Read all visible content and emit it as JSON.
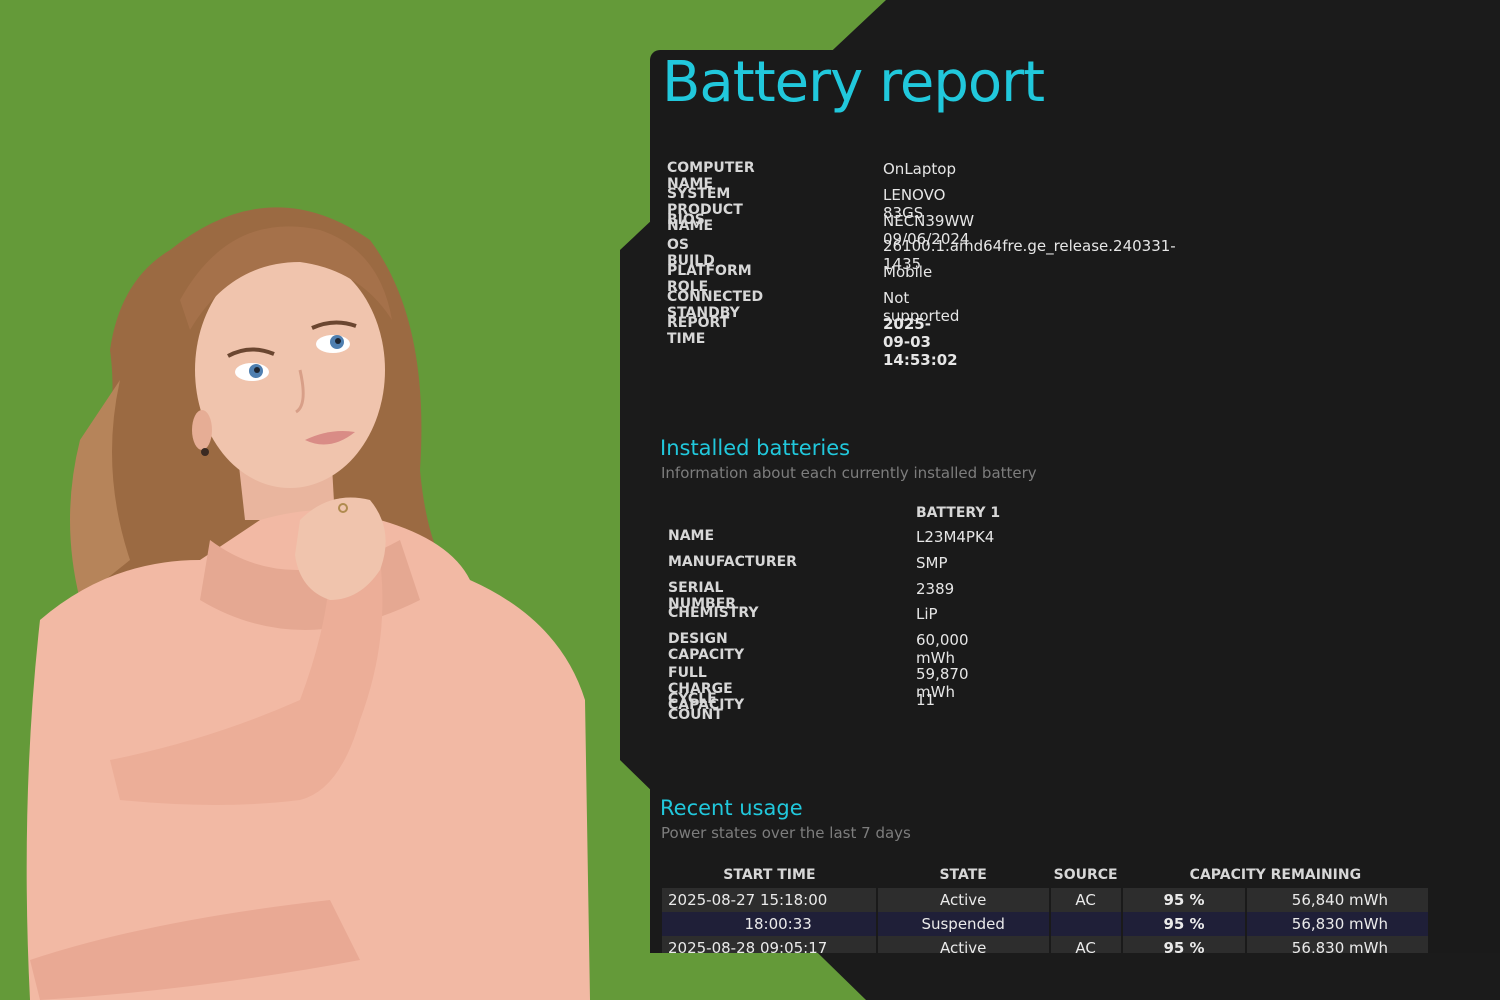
{
  "report": {
    "title": "Battery report",
    "system": [
      {
        "label": "COMPUTER NAME",
        "value": "OnLaptop"
      },
      {
        "label": "SYSTEM PRODUCT NAME",
        "value": "LENOVO 83GS"
      },
      {
        "label": "BIOS",
        "value": "NECN39WW 09/06/2024"
      },
      {
        "label": "OS BUILD",
        "value": "26100.1.amd64fre.ge_release.240331-1435"
      },
      {
        "label": "PLATFORM ROLE",
        "value": "Mobile"
      },
      {
        "label": "CONNECTED STANDBY",
        "value": "Not supported"
      },
      {
        "label": "REPORT TIME",
        "value": "2025-09-03  14:53:02"
      }
    ]
  },
  "batteries": {
    "heading": "Installed batteries",
    "subheading": "Information about each currently installed battery",
    "column": "BATTERY 1",
    "rows": [
      {
        "label": "NAME",
        "value": "L23M4PK4"
      },
      {
        "label": "MANUFACTURER",
        "value": "SMP"
      },
      {
        "label": "SERIAL NUMBER",
        "value": "2389"
      },
      {
        "label": "CHEMISTRY",
        "value": "LiP"
      },
      {
        "label": "DESIGN CAPACITY",
        "value": "60,000 mWh"
      },
      {
        "label": "FULL CHARGE CAPACITY",
        "value": "59,870 mWh"
      },
      {
        "label": "CYCLE COUNT",
        "value": "11"
      }
    ]
  },
  "usage": {
    "heading": "Recent usage",
    "subheading": "Power states over the last 7 days",
    "columns": [
      "START TIME",
      "STATE",
      "SOURCE",
      "CAPACITY REMAINING"
    ],
    "rows": [
      {
        "start": "2025-08-27  15:18:00",
        "state": "Active",
        "source": "AC",
        "pct": "95 %",
        "mwh": "56,840 mWh"
      },
      {
        "start": "18:00:33",
        "state": "Suspended",
        "source": "",
        "pct": "95 %",
        "mwh": "56,830 mWh"
      },
      {
        "start": "2025-08-28  09:05:17",
        "state": "Active",
        "source": "AC",
        "pct": "95 %",
        "mwh": "56,830 mWh"
      }
    ]
  },
  "colors": {
    "background_green": "#649a39",
    "panel": "#1a1a1a",
    "accent_cyan": "#21c8dc"
  }
}
